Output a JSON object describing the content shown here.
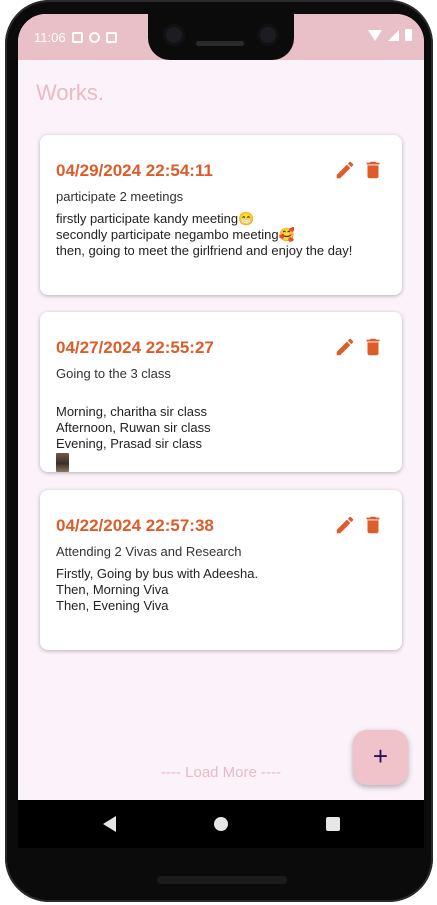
{
  "status_bar": {
    "time": "11:06",
    "left_icons": [
      "a-notification-icon",
      "p-notification-icon",
      "sd-card-icon"
    ],
    "right_icons": [
      "wifi-icon",
      "signal-icon",
      "battery-icon"
    ]
  },
  "app": {
    "title": "Works."
  },
  "cards": [
    {
      "date": "04/29/2024 22:54:11",
      "subtitle": "participate 2 meetings",
      "body": "firstly participate kandy meeting😁\nsecondly participate negambo meeting🥰\nthen, going to meet the girlfriend and enjoy the day!",
      "has_image": false
    },
    {
      "date": "04/27/2024 22:55:27",
      "subtitle": "Going to the 3 class",
      "body": "Morning, charitha sir class\nAfternoon, Ruwan sir class\nEvening, Prasad sir class",
      "has_image": true
    },
    {
      "date": "04/22/2024 22:57:38",
      "subtitle": "Attending 2 Vivas and Research",
      "body": "Firstly, Going by bus with Adeesha.\nThen, Morning Viva\nThen, Evening Viva",
      "has_image": false
    }
  ],
  "load_more_label": "---- Load More ----",
  "fab_label": "+",
  "colors": {
    "accent": "#dc5d2a",
    "title_pink": "#e9bac4",
    "status_bar": "#eac0c8",
    "background": "#fcf2fa",
    "fab_bg": "#f0c2c9"
  }
}
